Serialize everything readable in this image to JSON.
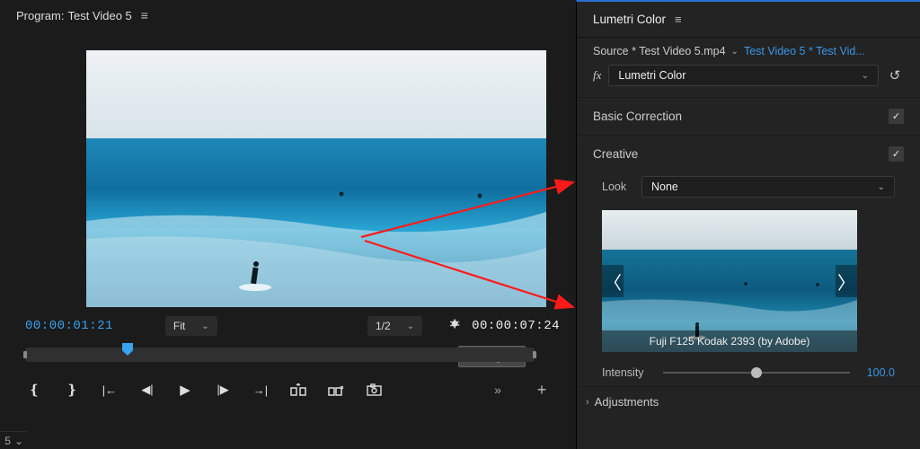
{
  "program": {
    "title_prefix": "Program:",
    "title": "Test Video 5",
    "timecode_current": "00:00:01:21",
    "timecode_duration": "00:00:07:24",
    "zoom_label": "Fit",
    "resolution_label": "1/2",
    "settings_tooltip": "Settings...",
    "bottom_misc": "5"
  },
  "lumetri": {
    "panel_title": "Lumetri Color",
    "source_label": "Source * Test Video 5.mp4",
    "sequence_label": "Test Video 5 * Test Vid...",
    "fx_name": "Lumetri Color",
    "sections": {
      "basic": "Basic Correction",
      "creative": "Creative",
      "adjustments": "Adjustments"
    },
    "creative": {
      "look_label": "Look",
      "look_value": "None",
      "lut_name": "Fuji F125 Kodak 2393 (by Adobe)",
      "intensity_label": "Intensity",
      "intensity_value": "100.0"
    },
    "checkbox_glyph": "✓"
  }
}
